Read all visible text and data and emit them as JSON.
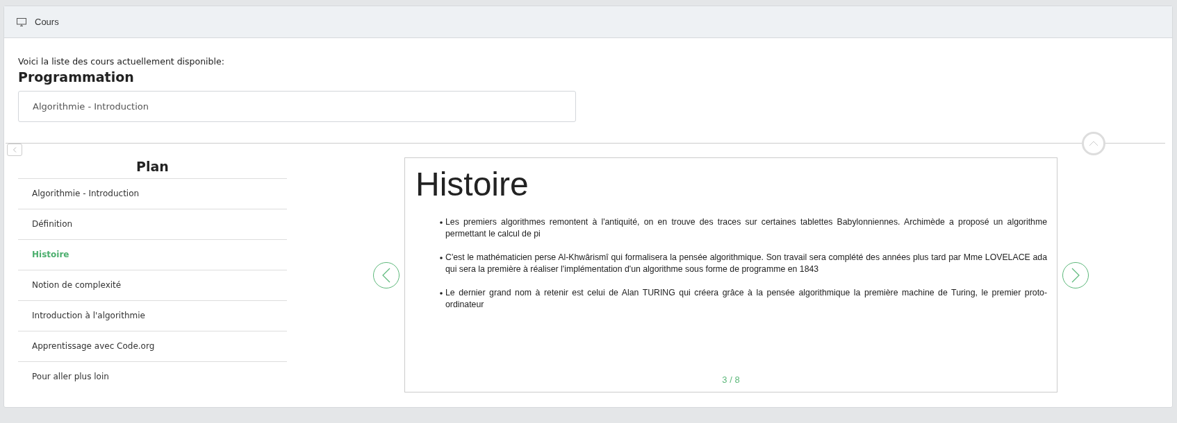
{
  "header": {
    "title": "Cours"
  },
  "intro": "Voici la liste des cours actuellement disponible:",
  "category": "Programmation",
  "course_select": {
    "value": "Algorithmie - Introduction"
  },
  "plan": {
    "title": "Plan",
    "items": [
      {
        "label": "Algorithmie - Introduction",
        "selected": false
      },
      {
        "label": "Définition",
        "selected": false
      },
      {
        "label": "Histoire",
        "selected": true
      },
      {
        "label": "Notion de complexité",
        "selected": false
      },
      {
        "label": "Introduction à l'algorithmie",
        "selected": false
      },
      {
        "label": "Apprentissage avec Code.org",
        "selected": false
      },
      {
        "label": "Pour aller plus loin",
        "selected": false
      }
    ]
  },
  "slide": {
    "title": "Histoire",
    "bullets": [
      "Les premiers algorithmes remontent à l'antiquité, on en trouve des traces sur certaines tablettes Babylonniennes. Archimède a proposé un algorithme permettant le calcul de pi",
      "C'est le mathématicien perse Al-Khwârismî qui formalisera la pensée algorithmique. Son travail sera complété des années plus tard par Mme LOVELACE ada qui sera la première à réaliser l'implémentation d'un algorithme sous forme de programme en 1843",
      "Le dernier grand nom à retenir est celui de Alan TURING qui créera grâce à la pensée algorithmique la première machine de Turing, le premier proto-ordinateur"
    ],
    "page": "3 / 8"
  }
}
